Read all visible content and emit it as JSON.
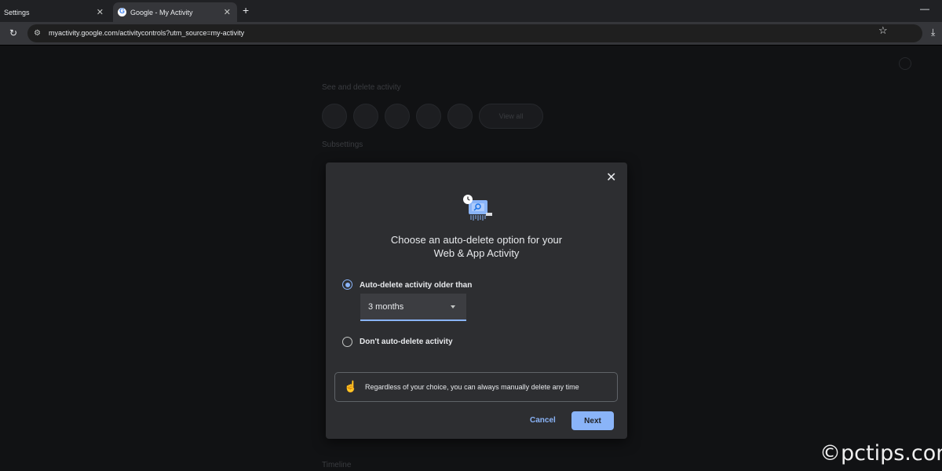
{
  "browser": {
    "tabs": [
      {
        "label": "Settings",
        "active": false
      },
      {
        "label": "Google - My Activity",
        "active": true
      }
    ],
    "url": "myactivity.google.com/activitycontrols?utm_source=my-activity"
  },
  "background_page": {
    "see_and_delete_heading": "See and delete activity",
    "view_all_label": "View all",
    "subsettings_heading": "Subsettings",
    "timeline_heading": "Timeline"
  },
  "dialog": {
    "title_line1": "Choose an auto-delete option for your",
    "title_line2": "Web & App Activity",
    "option_auto_delete": "Auto-delete activity older than",
    "option_auto_delete_selected": true,
    "select_value": "3 months",
    "option_dont_delete": "Don't auto-delete activity",
    "info_text": "Regardless of your choice, you can always manually delete any time",
    "cancel_label": "Cancel",
    "next_label": "Next"
  },
  "watermark": "©pctips.com",
  "colors": {
    "accent": "#8ab4f8",
    "dialog_bg": "#2d2e31",
    "page_bg": "#111214"
  },
  "icons": {
    "reload": "reload-icon",
    "star": "star-icon",
    "download": "download-icon",
    "close": "close-icon",
    "hand": "hand-icon"
  }
}
